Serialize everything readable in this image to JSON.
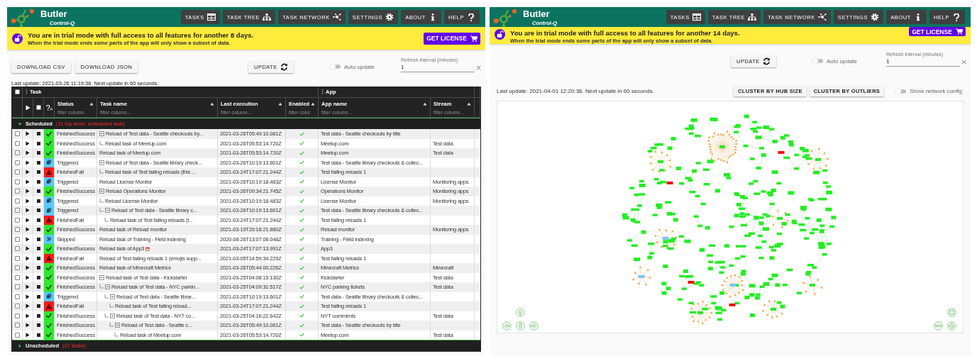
{
  "panels": [
    {
      "kind": "tasks",
      "header": {
        "app_name": "Butler",
        "app_subtitle": "Control-Q",
        "nav": [
          {
            "kind": "tasks",
            "label": "TASKS"
          },
          {
            "kind": "tree",
            "label": "TASK TREE"
          },
          {
            "kind": "network",
            "label": "TASK NETWORK"
          },
          {
            "kind": "settings",
            "label": "SETTINGS"
          },
          {
            "kind": "about",
            "label": "ABOUT"
          },
          {
            "kind": "help",
            "label": "HELP"
          }
        ]
      },
      "banner": {
        "title": "You are in trial mode with full access to all features for another 8 days.",
        "subtitle": "When the trial mode ends some parts of the app will only show a subset of data.",
        "button": "GET LICENSE"
      },
      "toolbar": {
        "buttons": [
          "DOWNLOAD CSV",
          "DOWNLOAD JSON"
        ],
        "update_button": "UPDATE",
        "auto_update": {
          "label": "Auto update",
          "on": false
        },
        "refresh_interval": {
          "label": "Refresh interval (minutes)",
          "value": "1"
        }
      },
      "last_update": "Last update: 2021-03-26 11:19:38. Next update in 60 seconds.",
      "table": {
        "select_all": {
          "checked": false
        },
        "column_groups": [
          {
            "label": "Task"
          },
          {
            "label": "App"
          }
        ],
        "columns": [
          {
            "label": "Status",
            "filter_placeholder": "filter column."
          },
          {
            "label": "Task name",
            "filter_placeholder": "filter column..."
          },
          {
            "label": "Last execution",
            "filter_placeholder": "filter column..."
          },
          {
            "label": "Enabled",
            "filter_placeholder": "filter colur"
          },
          {
            "label": "App name",
            "filter_placeholder": "filter column..."
          },
          {
            "label": "Stream",
            "filter_placeholder": "filter column..."
          }
        ],
        "groups": [
          {
            "label": "Scheduled",
            "count": "(11 top level, scheduled task)",
            "expanded": true,
            "rows": [
              {
                "checked": false,
                "kind": "success",
                "status": "FinishedSuccess",
                "name": "Reload of Test data - Seattle checkouts by...",
                "expanded": true,
                "last_execution": "2021-03-26T05:49:10.081Z",
                "enabled": true,
                "app": "Test data - Seattle checkouts by title",
                "children": [
                  {
                    "checked": false,
                    "kind": "success",
                    "status": "FinishedSuccess",
                    "name": "Reload task of Meetup.com",
                    "last_execution": "2021-03-26T05:53:14.720Z",
                    "enabled": true,
                    "app": "Meetup.com",
                    "stream": "Test data"
                  }
                ]
              },
              {
                "checked": false,
                "kind": "success",
                "status": "FinishedSuccess",
                "name": "Reload task of Meetup.com",
                "last_execution": "2021-03-26T05:53:14.720Z",
                "enabled": true,
                "app": "Meetup.com",
                "stream": "Test data"
              },
              {
                "checked": false,
                "kind": "triggered",
                "status": "Triggered",
                "name": "Reload of Test data - Seattle library check...",
                "expanded": true,
                "last_execution": "2021-03-26T10:19:13.601Z",
                "enabled": true,
                "app": "Test data - Seattle library checkouts & collec...",
                "children": [
                  {
                    "checked": false,
                    "kind": "fail",
                    "status": "FinishedFail",
                    "name": "Reload task of Test failing reloads (this ...",
                    "last_execution": "2021-03-24T17:07:21.244Z",
                    "enabled": true,
                    "app": "Test failing reloads 1"
                  }
                ]
              },
              {
                "checked": false,
                "kind": "triggered",
                "status": "Triggered",
                "name": "Reload License Monitor",
                "last_execution": "2021-03-26T10:19:18.483Z",
                "enabled": true,
                "app": "License Monitor",
                "stream": "Monitoring apps"
              },
              {
                "checked": false,
                "kind": "success",
                "status": "FinishedSuccess",
                "name": "Reload Operations Monitor",
                "expanded": true,
                "last_execution": "2021-03-26T09:34:21.745Z",
                "enabled": true,
                "app": "Operations Monitor",
                "stream": "Monitoring apps",
                "children": [
                  {
                    "checked": false,
                    "kind": "triggered",
                    "status": "Triggered",
                    "name": "Reload License Monitor",
                    "last_execution": "2021-03-26T10:19:18.483Z",
                    "enabled": true,
                    "app": "License Monitor",
                    "stream": "Monitoring apps"
                  },
                  {
                    "checked": false,
                    "kind": "triggered",
                    "status": "Triggered",
                    "name": "Reload of Test data - Seattle library c...",
                    "expanded": true,
                    "last_execution": "2021-03-26T10:19:13.601Z",
                    "enabled": true,
                    "app": "Test data - Seattle library checkouts & collec...",
                    "children": [
                      {
                        "checked": false,
                        "kind": "fail",
                        "status": "FinishedFail",
                        "name": "Reload task of Test failing reloads (t...",
                        "last_execution": "2021-03-24T17:07:21.244Z",
                        "enabled": true,
                        "app": "Test failing reloads 1"
                      }
                    ]
                  }
                ]
              },
              {
                "checked": false,
                "kind": "success",
                "status": "FinishedSuccess",
                "name": "Reload task of Reload monitor",
                "last_execution": "2021-03-19T20:18:21.880Z",
                "enabled": true,
                "app": "Reload monitor",
                "stream": "Monitoring apps"
              },
              {
                "checked": false,
                "kind": "skipped",
                "status": "Skipped",
                "name": "Reload task of Training - Field indexing",
                "last_execution": "2020-08-26T13:07:08.048Z",
                "enabled": true,
                "app": "Training - Field indexing"
              },
              {
                "checked": false,
                "kind": "success",
                "status": "FinishedSuccess",
                "name": "Reload task of App3",
                "name_icon": true,
                "last_execution": "2021-03-24T17:07:13.991Z",
                "enabled": true,
                "app": "App3"
              },
              {
                "checked": false,
                "kind": "fail",
                "status": "FinishedFail",
                "name": "Reload of Test failing reloads 1 (emojis supp...",
                "last_execution": "2021-03-05T14:59:34.229Z",
                "enabled": true,
                "app": "Test failing reloads 1"
              },
              {
                "checked": false,
                "kind": "success",
                "status": "FinishedSuccess",
                "name": "Reload task of Minecraft Metrics",
                "last_execution": "2021-03-26T05:44:00.226Z",
                "enabled": true,
                "app": "Minecraft Metrics",
                "stream": "Minecraft"
              },
              {
                "checked": false,
                "kind": "success",
                "status": "FinishedSuccess",
                "name": "Reload task of Test data - Kickstarter",
                "expanded": true,
                "last_execution": "2021-03-25T04:08:15.130Z",
                "enabled": true,
                "app": "Kickstarter",
                "stream": "Test data",
                "children": [
                  {
                    "checked": false,
                    "kind": "success",
                    "status": "FinishedSuccess",
                    "name": "Reload task of Test data - NYC parkin...",
                    "expanded": true,
                    "last_execution": "2021-03-25T04:09:32.517Z",
                    "enabled": true,
                    "app": "NYC parking tickets",
                    "stream": "Test data",
                    "children": [
                      {
                        "checked": false,
                        "kind": "triggered",
                        "status": "Triggered",
                        "name": "Reload of Test data - Seattle librar...",
                        "expanded": true,
                        "last_execution": "2021-03-26T10:19:13.601Z",
                        "enabled": true,
                        "app": "Test data - Seattle library checkouts & collec...",
                        "children": [
                          {
                            "checked": false,
                            "kind": "fail",
                            "status": "FinishedFail",
                            "name": "Reload task of Test failing reload...",
                            "last_execution": "2021-03-24T17:07:21.244Z",
                            "enabled": true,
                            "app": "Test failing reloads 1"
                          }
                        ]
                      },
                      {
                        "checked": false,
                        "kind": "success",
                        "status": "FinishedSuccess",
                        "name": "Reload task of Test data - NYT co...",
                        "expanded": true,
                        "last_execution": "2021-03-25T04:16:22.642Z",
                        "enabled": true,
                        "app": "NYT comments",
                        "stream": "Test data",
                        "children": [
                          {
                            "checked": false,
                            "kind": "success",
                            "status": "FinishedSuccess",
                            "name": "Reload of Test data - Seattle c...",
                            "expanded": true,
                            "last_execution": "2021-03-26T05:49:10.081Z",
                            "enabled": true,
                            "app": "Test data - Seattle checkouts by title",
                            "children": [
                              {
                                "checked": false,
                                "kind": "success",
                                "status": "FinishedSuccess",
                                "name": "Reload task of Meetup.com",
                                "last_execution": "2021-03-26T05:53:14.720Z",
                                "enabled": true,
                                "app": "Meetup.com",
                                "stream": "Test data"
                              }
                            ]
                          }
                        ]
                      }
                    ]
                  }
                ]
              }
            ]
          },
          {
            "label": "Unscheduled",
            "count": "(37 tasks)",
            "expanded": false
          }
        ]
      }
    },
    {
      "kind": "network",
      "header": {
        "app_name": "Butler",
        "app_subtitle": "Control-Q",
        "nav": [
          {
            "kind": "tasks",
            "label": "TASKS"
          },
          {
            "kind": "tree",
            "label": "TASK TREE"
          },
          {
            "kind": "network",
            "label": "TASK NETWORK"
          },
          {
            "kind": "settings",
            "label": "SETTINGS"
          },
          {
            "kind": "about",
            "label": "ABOUT"
          },
          {
            "kind": "help",
            "label": "HELP"
          }
        ]
      },
      "banner": {
        "title": "You are in trial mode with full access to all features for another 14 days.",
        "subtitle": "When the trial mode ends some parts of the app will only show a subset of data.",
        "button": "GET LICENSE"
      },
      "toolbar": {
        "update_button": "UPDATE",
        "auto_update": {
          "label": "Auto update",
          "on": false
        },
        "refresh_interval": {
          "label": "Refresh interval (minutes)",
          "value": "1"
        }
      },
      "last_update": "Last update: 2021-04-01 12:20:36. Next update in 60 seconds.",
      "cluster_buttons": [
        "CLUSTER BY HUB SIZE",
        "CLUSTER BY OUTLIERS"
      ],
      "network_config": {
        "label": "Show network config",
        "on": false
      }
    }
  ]
}
